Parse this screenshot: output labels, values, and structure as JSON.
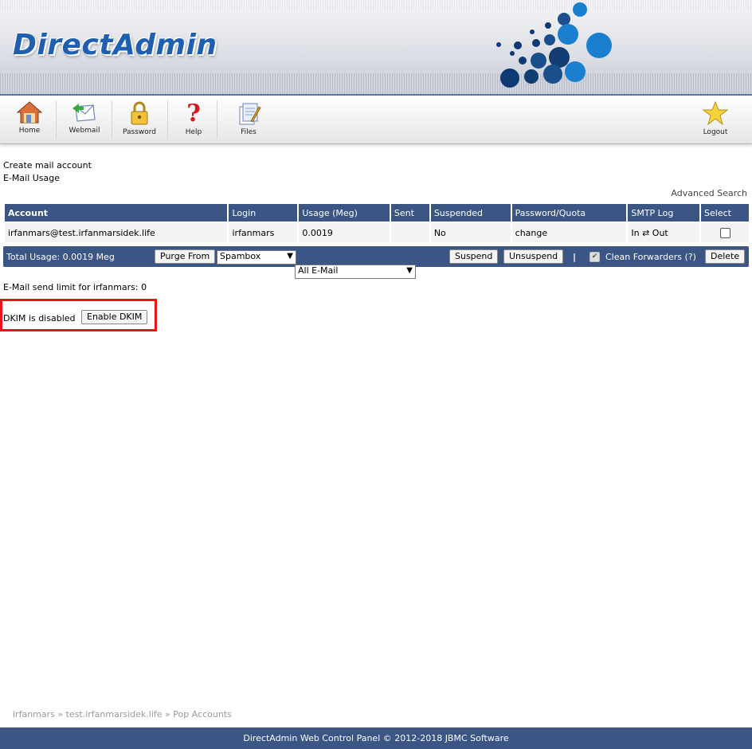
{
  "brand": {
    "logo_text": "DirectAdmin"
  },
  "toolbar": {
    "home": "Home",
    "webmail": "Webmail",
    "password": "Password",
    "help": "Help",
    "files": "Files",
    "logout": "Logout"
  },
  "links": {
    "create_account": "Create mail account",
    "email_usage": "E-Mail Usage",
    "advanced_search": "Advanced Search"
  },
  "table": {
    "headers": [
      "Account",
      "Login",
      "Usage (Meg)",
      "Sent",
      "Suspended",
      "Password/Quota",
      "SMTP Log",
      "Select"
    ],
    "rows": [
      {
        "account": "irfanmars@test.irfanmarsidek.life",
        "login": "irfanmars",
        "usage": "0.0019",
        "sent": "",
        "suspended": "No",
        "password_quota": "change",
        "smtp_log": "In ⇄ Out"
      }
    ]
  },
  "actions": {
    "total_usage": "Total Usage: 0.0019 Meg",
    "purge_from": "Purge From",
    "purge_folder": "Spambox",
    "purge_filter": "All E-Mail",
    "suspend": "Suspend",
    "unsuspend": "Unsuspend",
    "separator": "|",
    "clean_forwarders": "Clean Forwarders (?)",
    "delete": "Delete"
  },
  "send_limit": "E-Mail send limit for irfanmars: 0",
  "dkim": {
    "status": "DKIM is disabled",
    "enable_button": "Enable DKIM",
    "highlight_color": "#e8141a"
  },
  "breadcrumb": {
    "items": [
      "irfanmars",
      "test.irfanmarsidek.life",
      "Pop Accounts"
    ],
    "separator": "»"
  },
  "footer": {
    "copyright": "DirectAdmin Web Control Panel © 2012-2018 JBMC Software"
  },
  "colors": {
    "header_blue": "#3b5584",
    "logo_blue": "#1f5fb0"
  }
}
